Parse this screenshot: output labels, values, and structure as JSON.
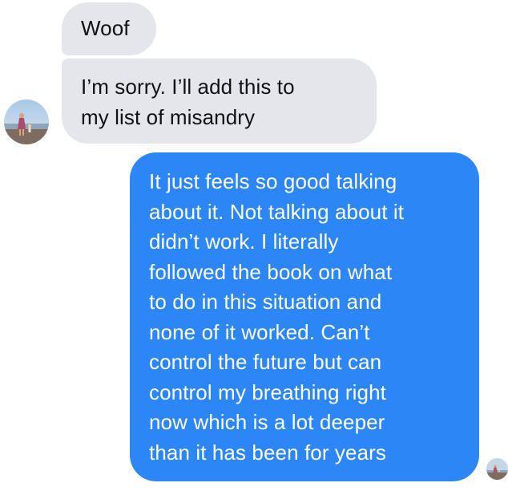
{
  "thread": {
    "messages": [
      {
        "sender": "other",
        "text": "Woof"
      },
      {
        "sender": "other",
        "text": "I’m sorry. I’ll add this to\nmy list of misandry"
      },
      {
        "sender": "self",
        "text": "It just feels so good talking\nabout it. Not talking about it\ndidn’t work. I literally\nfollowed the book on what\nto do in this situation and\nnone of it worked. Can’t\ncontrol the future but can\ncontrol my breathing right\nnow which is a lot deeper\nthan it has been for years"
      }
    ],
    "avatars": {
      "other": {
        "icon": "beach-photo-avatar"
      },
      "self": {
        "icon": "beach-photo-avatar"
      }
    }
  },
  "colors": {
    "incoming_bubble": "#e4e6eb",
    "incoming_text": "#111111",
    "outgoing_bubble": "#2d86f6",
    "outgoing_text": "#ffffff"
  }
}
